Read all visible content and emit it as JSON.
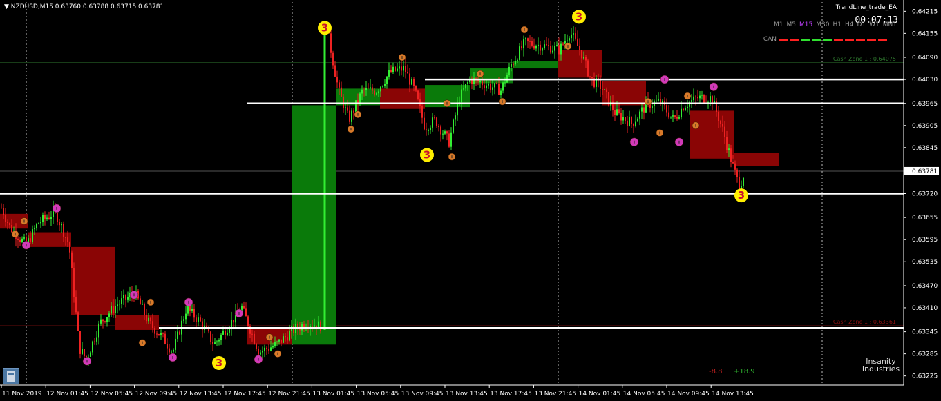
{
  "window": {
    "symbol_info": "NZDUSD,M15  0.63760 0.63788 0.63715 0.63781",
    "ea_name": "TrendLine_trade_EA",
    "timer": "00:07:13",
    "timeframes": [
      "M1",
      "M5",
      "M15",
      "M30",
      "H1",
      "H4",
      "D1",
      "W1",
      "MN1"
    ],
    "active_timeframe": "M15",
    "can_label": "CAN",
    "can_colors": [
      "#ff2020",
      "#ff2020",
      "#30e030",
      "#30e030",
      "#30e030",
      "#ff2020",
      "#ff2020",
      "#ff2020",
      "#ff2020",
      "#ff2020"
    ],
    "brand_line1": "Insanity",
    "brand_line2": "Industries",
    "pl_negative": "-8.8",
    "pl_positive": "+18.9"
  },
  "colors": {
    "background": "#000000",
    "axis_text": "#ffffff",
    "bull": "#33ee33",
    "bear": "#ee2222",
    "zone_green": "#0a7a0a",
    "zone_red": "#8a0505",
    "level": "#ffffff",
    "marker_orange": "#d87a2a",
    "marker_magenta": "#d23ab8",
    "marker_yellow": "#ffee00"
  },
  "chart_data": {
    "type": "candlestick",
    "symbol": "NZDUSD",
    "timeframe": "M15",
    "ylim": [
      0.632,
      0.6424
    ],
    "price_ticks": [
      "0.64215",
      "0.64155",
      "0.64090",
      "0.64030",
      "0.63965",
      "0.63905",
      "0.63845",
      "0.63781",
      "0.63720",
      "0.63655",
      "0.63595",
      "0.63535",
      "0.63470",
      "0.63410",
      "0.63345",
      "0.63285",
      "0.63225"
    ],
    "current_price": "0.63781",
    "time_ticks": [
      "11 Nov 2019",
      "12 Nov 01:45",
      "12 Nov 05:45",
      "12 Nov 09:45",
      "12 Nov 13:45",
      "12 Nov 17:45",
      "12 Nov 21:45",
      "13 Nov 01:45",
      "13 Nov 05:45",
      "13 Nov 09:45",
      "13 Nov 13:45",
      "13 Nov 17:45",
      "13 Nov 21:45",
      "14 Nov 01:45",
      "14 Nov 05:45",
      "14 Nov 09:45",
      "14 Nov 13:45"
    ],
    "price_path": [
      [
        0,
        0.6369
      ],
      [
        14,
        0.6363
      ],
      [
        38,
        0.6358
      ],
      [
        55,
        0.6364
      ],
      [
        80,
        0.6367
      ],
      [
        100,
        0.6358
      ],
      [
        115,
        0.633
      ],
      [
        125,
        0.6327
      ],
      [
        145,
        0.6337
      ],
      [
        170,
        0.6342
      ],
      [
        195,
        0.6345
      ],
      [
        215,
        0.6337
      ],
      [
        235,
        0.6333
      ],
      [
        250,
        0.6329
      ],
      [
        270,
        0.6341
      ],
      [
        290,
        0.6337
      ],
      [
        310,
        0.6331
      ],
      [
        330,
        0.6336
      ],
      [
        350,
        0.6341
      ],
      [
        375,
        0.6329
      ],
      [
        400,
        0.6331
      ],
      [
        425,
        0.6335
      ],
      [
        445,
        0.6337
      ],
      [
        465,
        0.6336
      ],
      [
        470,
        0.642
      ],
      [
        480,
        0.641
      ],
      [
        490,
        0.64
      ],
      [
        505,
        0.6392
      ],
      [
        525,
        0.64
      ],
      [
        545,
        0.64
      ],
      [
        565,
        0.6405
      ],
      [
        585,
        0.6406
      ],
      [
        600,
        0.64
      ],
      [
        615,
        0.639
      ],
      [
        630,
        0.6392
      ],
      [
        650,
        0.6386
      ],
      [
        665,
        0.6398
      ],
      [
        680,
        0.6403
      ],
      [
        700,
        0.6402
      ],
      [
        725,
        0.64
      ],
      [
        740,
        0.6407
      ],
      [
        760,
        0.6413
      ],
      [
        790,
        0.6412
      ],
      [
        810,
        0.6411
      ],
      [
        825,
        0.6416
      ],
      [
        842,
        0.641
      ],
      [
        855,
        0.6403
      ],
      [
        870,
        0.6401
      ],
      [
        890,
        0.6394
      ],
      [
        915,
        0.6391
      ],
      [
        935,
        0.6396
      ],
      [
        955,
        0.6397
      ],
      [
        975,
        0.6392
      ],
      [
        990,
        0.6396
      ],
      [
        1010,
        0.6398
      ],
      [
        1030,
        0.6398
      ],
      [
        1045,
        0.639
      ],
      [
        1060,
        0.638
      ],
      [
        1070,
        0.6374
      ],
      [
        1078,
        0.63781
      ]
    ],
    "zones": [
      {
        "color": "red",
        "x": [
          0,
          40
        ],
        "price": [
          0.63625,
          0.63665
        ]
      },
      {
        "color": "red",
        "x": [
          40,
          103
        ],
        "price": [
          0.63575,
          0.63615
        ]
      },
      {
        "color": "red",
        "x": [
          103,
          167
        ],
        "price": [
          0.6339,
          0.63575
        ]
      },
      {
        "color": "red",
        "x": [
          167,
          230
        ],
        "price": [
          0.6335,
          0.6339
        ]
      },
      {
        "color": "red",
        "x": [
          358,
          423
        ],
        "price": [
          0.6331,
          0.63355
        ]
      },
      {
        "color": "green",
        "x": [
          423,
          487
        ],
        "price": [
          0.6331,
          0.6396
        ]
      },
      {
        "color": "green",
        "x": [
          487,
          550
        ],
        "price": [
          0.6396,
          0.64005
        ]
      },
      {
        "color": "red",
        "x": [
          550,
          615
        ],
        "price": [
          0.6395,
          0.64005
        ]
      },
      {
        "color": "green",
        "x": [
          615,
          680
        ],
        "price": [
          0.63955,
          0.64015
        ]
      },
      {
        "color": "green",
        "x": [
          680,
          743
        ],
        "price": [
          0.6402,
          0.6406
        ]
      },
      {
        "color": "green",
        "x": [
          743,
          808
        ],
        "price": [
          0.6406,
          0.6408
        ]
      },
      {
        "color": "red",
        "x": [
          808,
          871
        ],
        "price": [
          0.64035,
          0.6411
        ]
      },
      {
        "color": "red",
        "x": [
          871,
          935
        ],
        "price": [
          0.6396,
          0.64025
        ]
      },
      {
        "color": "red",
        "x": [
          999,
          1063
        ],
        "price": [
          0.63815,
          0.63945
        ]
      },
      {
        "color": "red",
        "x": [
          1063,
          1127
        ],
        "price": [
          0.63795,
          0.6383
        ]
      }
    ],
    "levels": [
      {
        "price": 0.63965,
        "x_from": 358
      },
      {
        "price": 0.6403,
        "x_from": 615
      },
      {
        "price": 0.6372,
        "x_from": 0
      },
      {
        "price": 0.63355,
        "x_from": 230
      }
    ],
    "thin_lines": [
      {
        "price": 0.64075,
        "color": "#2f7a2f",
        "label": "Cash Zone 1 : 0.64075"
      },
      {
        "price": 0.63361,
        "color": "#8a1010",
        "label": "Cash Zone 1 : 0.63361"
      },
      {
        "price": 0.63781,
        "color": "#555555",
        "label": ""
      }
    ],
    "vertical_dotted": [
      38,
      423,
      808,
      1190
    ],
    "markers": [
      {
        "x": 22,
        "price": 0.6361,
        "kind": "orange"
      },
      {
        "x": 35,
        "price": 0.63645,
        "kind": "orange"
      },
      {
        "x": 38,
        "price": 0.6358,
        "kind": "magenta"
      },
      {
        "x": 82,
        "price": 0.6368,
        "kind": "magenta"
      },
      {
        "x": 126,
        "price": 0.63265,
        "kind": "magenta"
      },
      {
        "x": 194,
        "price": 0.63445,
        "kind": "magenta"
      },
      {
        "x": 206,
        "price": 0.63315,
        "kind": "orange"
      },
      {
        "x": 218,
        "price": 0.63425,
        "kind": "orange"
      },
      {
        "x": 250,
        "price": 0.63275,
        "kind": "magenta"
      },
      {
        "x": 273,
        "price": 0.63425,
        "kind": "magenta"
      },
      {
        "x": 346,
        "price": 0.63395,
        "kind": "magenta"
      },
      {
        "x": 374,
        "price": 0.6327,
        "kind": "magenta"
      },
      {
        "x": 390,
        "price": 0.6333,
        "kind": "orange"
      },
      {
        "x": 402,
        "price": 0.63285,
        "kind": "orange"
      },
      {
        "x": 508,
        "price": 0.63895,
        "kind": "orange"
      },
      {
        "x": 518,
        "price": 0.63935,
        "kind": "orange"
      },
      {
        "x": 582,
        "price": 0.6409,
        "kind": "orange"
      },
      {
        "x": 647,
        "price": 0.63965,
        "kind": "orange"
      },
      {
        "x": 654,
        "price": 0.6382,
        "kind": "orange"
      },
      {
        "x": 695,
        "price": 0.64045,
        "kind": "orange"
      },
      {
        "x": 727,
        "price": 0.6397,
        "kind": "orange"
      },
      {
        "x": 759,
        "price": 0.64165,
        "kind": "orange"
      },
      {
        "x": 822,
        "price": 0.6412,
        "kind": "orange"
      },
      {
        "x": 938,
        "price": 0.6397,
        "kind": "orange"
      },
      {
        "x": 918,
        "price": 0.6386,
        "kind": "magenta"
      },
      {
        "x": 955,
        "price": 0.63885,
        "kind": "orange"
      },
      {
        "x": 962,
        "price": 0.6403,
        "kind": "magenta"
      },
      {
        "x": 983,
        "price": 0.6386,
        "kind": "magenta"
      },
      {
        "x": 995,
        "price": 0.63985,
        "kind": "orange"
      },
      {
        "x": 1007,
        "price": 0.63905,
        "kind": "orange"
      },
      {
        "x": 1033,
        "price": 0.6401,
        "kind": "magenta"
      }
    ],
    "big_markers": [
      {
        "x": 470,
        "price": 0.6417,
        "label": "3"
      },
      {
        "x": 838,
        "price": 0.642,
        "label": "3"
      },
      {
        "x": 618,
        "price": 0.63825,
        "label": "3"
      },
      {
        "x": 317,
        "price": 0.6326,
        "label": "3"
      },
      {
        "x": 1073,
        "price": 0.63715,
        "label": "3"
      }
    ]
  }
}
